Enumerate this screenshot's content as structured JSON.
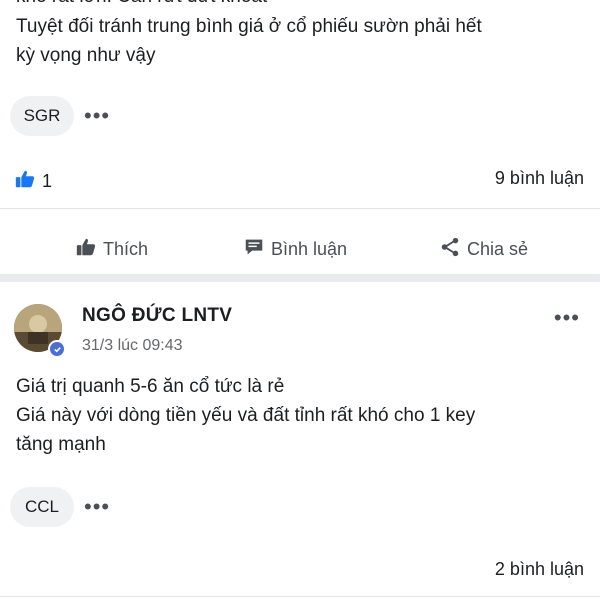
{
  "post1": {
    "cut_line": "khó rất lớn. Cắn rứt dứt khoát",
    "text_lines": [
      "Tuyệt đối tránh trung bình giá ở cổ phiếu sườn phải hết",
      "kỳ vọng như vậy"
    ],
    "tag": "SGR",
    "more": "•••",
    "like_count": "1",
    "comment_count": "9 bình luận",
    "actions": {
      "like": "Thích",
      "comment": "Bình luận",
      "share": "Chia sẻ"
    },
    "icons": {
      "like_reaction": "thumbs-up-icon",
      "like": "thumbs-up-icon",
      "comment": "comment-icon",
      "share": "share-icon"
    }
  },
  "post2": {
    "author": "NGÔ ĐỨC LNTV",
    "time": "31/3 lúc 09:43",
    "more": "•••",
    "text_lines": [
      "Giá trị quanh 5-6 ăn cổ tức là rẻ",
      "Giá này với dòng tiền yếu và đất tỉnh rất khó cho 1 key",
      "tăng mạnh"
    ],
    "tag": "CCL",
    "comment_count": "2 bình luận",
    "icons": {
      "avatar": "avatar",
      "verified": "verified-badge-icon"
    }
  },
  "colors": {
    "text": "#1c1e21",
    "muted": "#4b4f56",
    "like_blue": "#1877f2",
    "chip_bg": "#f0f1f3"
  }
}
